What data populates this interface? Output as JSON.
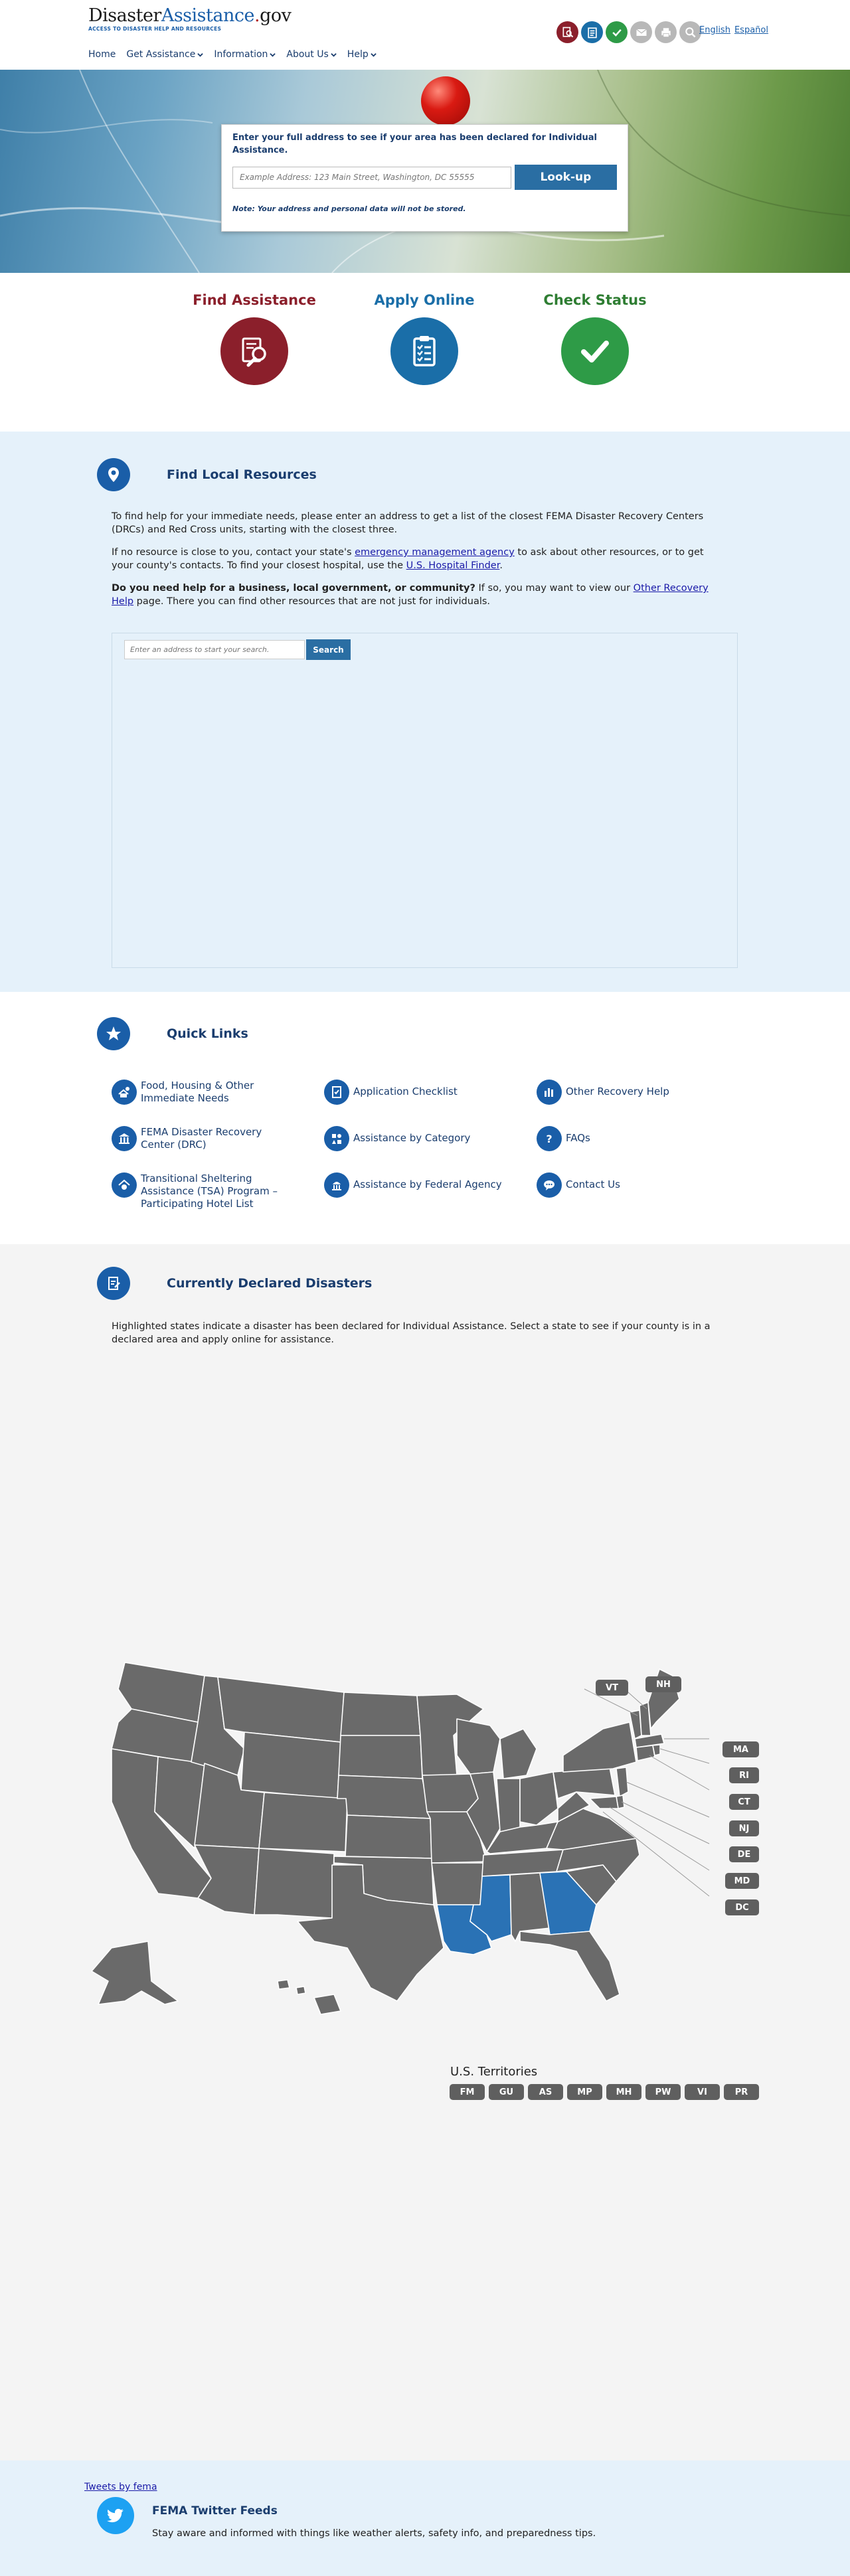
{
  "header": {
    "logo_disaster": "Disaster",
    "logo_assistance": "Assistance",
    "logo_dot": ".",
    "logo_gov": "gov",
    "logo_tagline": "ACCESS TO DISASTER HELP AND RESOURCES",
    "tools": [
      {
        "icon": "find-assistance-icon",
        "color": "#8b1f2b"
      },
      {
        "icon": "apply-online-icon",
        "color": "#1a6ea8"
      },
      {
        "icon": "check-status-icon",
        "color": "#2e9b47"
      },
      {
        "icon": "email-icon",
        "color": "#b8b8b8"
      },
      {
        "icon": "print-icon",
        "color": "#b8b8b8"
      },
      {
        "icon": "search-icon",
        "color": "#b8b8b8"
      }
    ],
    "lang_english": "English",
    "lang_espanol": "Español"
  },
  "nav": {
    "home": "Home",
    "get_assistance": "Get Assistance",
    "information": "Information",
    "about_us": "About Us",
    "help": "Help"
  },
  "hero": {
    "lookup_title": "Enter your full address to see if your area has been declared for Individual Assistance.",
    "address_placeholder": "Example Address: 123 Main Street, Washington, DC 55555",
    "lookup_button": "Look-up",
    "note": "Note: Your address and personal data will not be stored."
  },
  "actions": [
    {
      "label": "Find Assistance",
      "color": "#8b1f2b"
    },
    {
      "label": "Apply Online",
      "color": "#1a6ea8"
    },
    {
      "label": "Check Status",
      "color": "#2e9b47"
    }
  ],
  "local": {
    "title": "Find Local Resources",
    "p1": "To find help for your immediate needs, please enter an address to get a list of the closest FEMA Disaster Recovery Centers (DRCs) and Red Cross units, starting with the closest three.",
    "p2_a": "If no resource is close to you, contact your state's ",
    "p2_link1": "emergency management agency",
    "p2_b": " to ask about other resources, or to get your county's contacts. To find your closest hospital, use the ",
    "p2_link2": "U.S. Hospital Finder",
    "p2_c": ".",
    "p3_bold": "Do you need help for a business, local government, or community?",
    "p3_a": " If so, you may want to view our ",
    "p3_link": "Other Recovery Help",
    "p3_b": " page. There you can find other resources that are not just for individuals.",
    "search_placeholder": "Enter an address to start your search.",
    "search_button": "Search"
  },
  "quick_links": {
    "title": "Quick Links",
    "items": [
      {
        "label": "Food, Housing & Other Immediate Needs",
        "icon": "food-housing-icon"
      },
      {
        "label": "Application Checklist",
        "icon": "checklist-icon"
      },
      {
        "label": "Other Recovery Help",
        "icon": "recovery-help-icon"
      },
      {
        "label": "FEMA Disaster Recovery Center (DRC)",
        "icon": "drc-icon"
      },
      {
        "label": "Assistance by Category",
        "icon": "category-icon"
      },
      {
        "label": "FAQs",
        "icon": "faq-icon"
      },
      {
        "label": "Transitional Sheltering Assistance (TSA) Program – Participating Hotel List",
        "icon": "shelter-icon"
      },
      {
        "label": "Assistance by Federal Agency",
        "icon": "federal-agency-icon"
      },
      {
        "label": "Contact Us",
        "icon": "contact-icon"
      }
    ]
  },
  "declared": {
    "title": "Currently Declared Disasters",
    "text": "Highlighted states indicate a disaster has been declared for Individual Assistance. Select a state to see if your county is in a declared area and apply online for assistance.",
    "highlighted_states": [
      "Louisiana",
      "Mississippi",
      "Georgia"
    ],
    "highlight_color": "#2a72b5",
    "state_color": "#6a6a6a",
    "small_states": [
      "VT",
      "NH",
      "MA",
      "RI",
      "CT",
      "NJ",
      "DE",
      "MD",
      "DC"
    ],
    "territories_title": "U.S. Territories",
    "territories": [
      "FM",
      "GU",
      "AS",
      "MP",
      "MH",
      "PW",
      "VI",
      "PR"
    ]
  },
  "twitter": {
    "tweets_link": "Tweets by fema",
    "title": "FEMA Twitter Feeds",
    "text": "Stay aware and informed with things like weather alerts, safety info, and preparedness tips."
  }
}
